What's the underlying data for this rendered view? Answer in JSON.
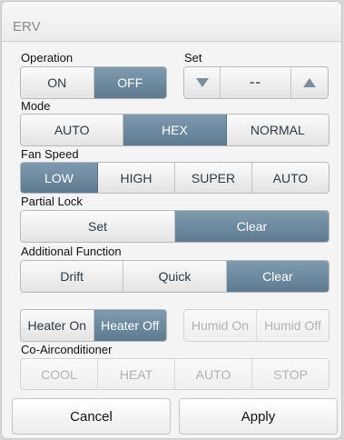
{
  "dialog": {
    "title": "ERV"
  },
  "operation": {
    "label": "Operation",
    "on": "ON",
    "off": "OFF",
    "selected": "OFF"
  },
  "set": {
    "label": "Set",
    "value": "--",
    "down_icon": "triangle-down",
    "up_icon": "triangle-up"
  },
  "mode": {
    "label": "Mode",
    "options": [
      "AUTO",
      "HEX",
      "NORMAL"
    ],
    "selected": "HEX"
  },
  "fan_speed": {
    "label": "Fan Speed",
    "options": [
      "LOW",
      "HIGH",
      "SUPER",
      "AUTO"
    ],
    "selected": "LOW"
  },
  "partial_lock": {
    "label": "Partial Lock",
    "options": [
      "Set",
      "Clear"
    ],
    "selected": "Clear"
  },
  "additional_function": {
    "label": "Additional Function",
    "options": [
      "Drift",
      "Quick",
      "Clear"
    ],
    "selected": "Clear"
  },
  "heater": {
    "on": "Heater On",
    "off": "Heater Off",
    "selected": "Heater Off"
  },
  "humid": {
    "on": "Humid On",
    "off": "Humid Off",
    "enabled": false
  },
  "co_airconditioner": {
    "label": "Co-Airconditioner",
    "options": [
      "COOL",
      "HEAT",
      "AUTO",
      "STOP"
    ],
    "enabled": false
  },
  "footer": {
    "cancel": "Cancel",
    "apply": "Apply"
  },
  "colors": {
    "active": "#6b879c",
    "accent_text": "#ffffff",
    "disabled_text": "#b2b2b2"
  }
}
